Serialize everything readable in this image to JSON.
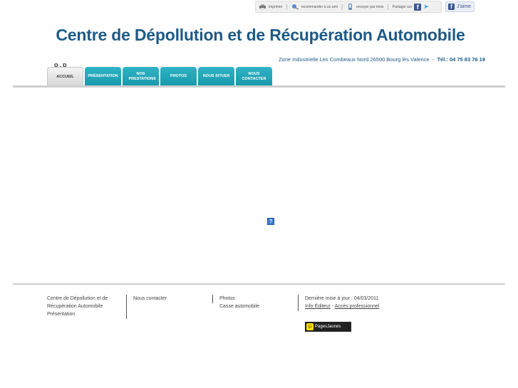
{
  "utility": {
    "print_label": "imprimer",
    "recommend_label": "recommander à un ami",
    "send_label": "envoyer par mms",
    "share_label": "Partager sur",
    "like_label": "J'aime"
  },
  "header": {
    "title": "Centre de Dépollution et de Récupération Automobile",
    "address": "Zone Industrielle Les Combeaux Nord 26500 Bourg lès Valence",
    "address_sep": "-",
    "tel": "Tél.: 04 75 83 76 19",
    "logo_fragment": "o.p"
  },
  "nav": {
    "tabs": [
      {
        "label": "ACCUEIL",
        "active": true
      },
      {
        "label": "PRÉSENTATION",
        "active": false
      },
      {
        "label": "NOS PRESTATIONS",
        "active": false
      },
      {
        "label": "PHOTOS",
        "active": false
      },
      {
        "label": "NOUS SITUER",
        "active": false
      },
      {
        "label": "NOUS CONTACTER",
        "active": false
      }
    ]
  },
  "main": {
    "missing_image_glyph": "?"
  },
  "footer": {
    "col1": [
      "Centre de Dépollution et de Récupération Automobile",
      "Présentation"
    ],
    "col2": [
      "Nous contacter"
    ],
    "col3": [
      "Photos",
      "Casse automobile"
    ],
    "col4": {
      "updated": "Dernière mise à jour : 04/03/2011",
      "info_editor": "Info Éditeur",
      "dash": "-",
      "pro_access": "Accès professionnel"
    },
    "badge_label": "PagesJaunes"
  },
  "colors": {
    "title": "#1e5a86",
    "tab": "#1fa3b5",
    "tab_active": "#e4e4e4"
  }
}
